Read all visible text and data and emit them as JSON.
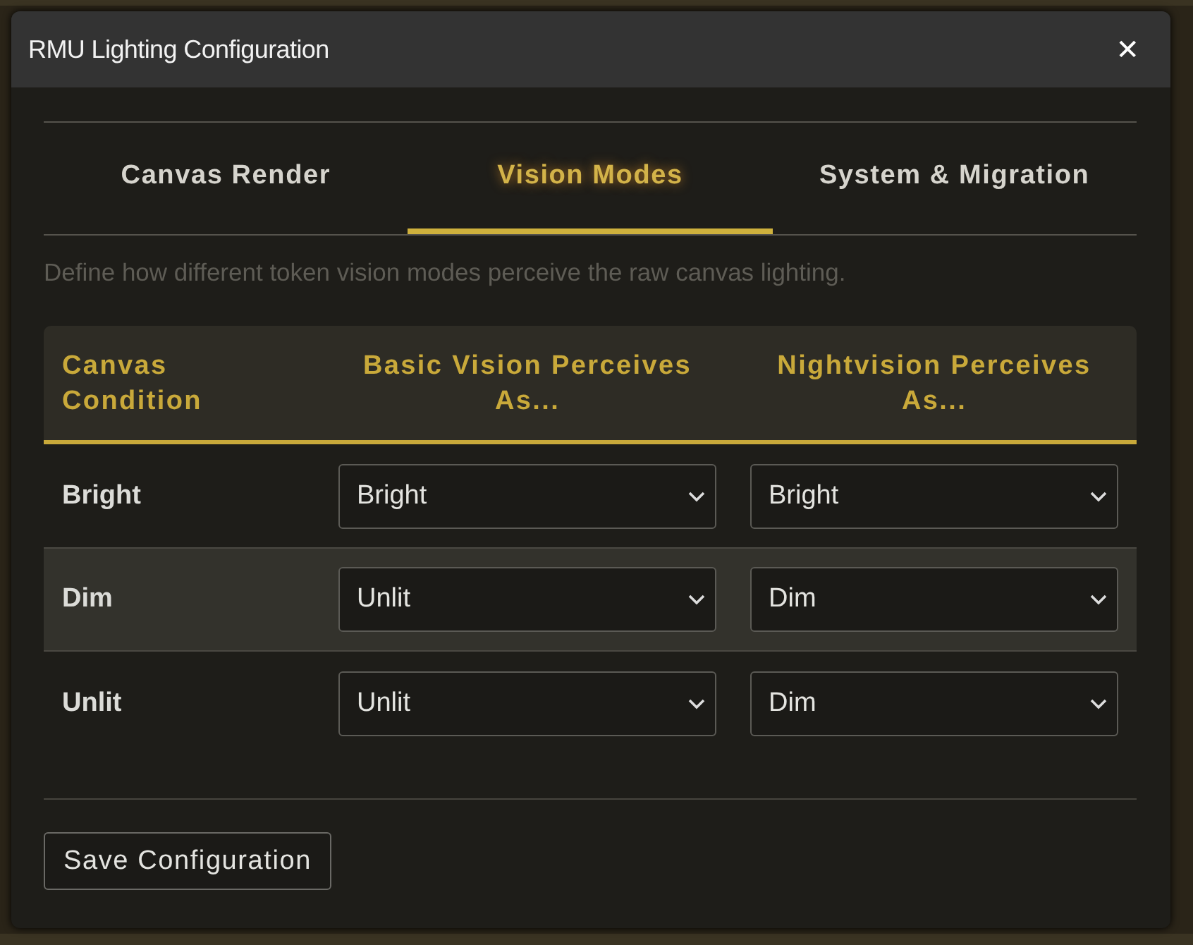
{
  "window": {
    "title": "RMU Lighting Configuration",
    "close": "✕"
  },
  "tabs": [
    {
      "label": "Canvas Render",
      "selected": false
    },
    {
      "label": "Vision Modes",
      "selected": true
    },
    {
      "label": "System & Migration",
      "selected": false
    }
  ],
  "description": "Define how different token vision modes perceive the raw canvas lighting.",
  "table": {
    "columns": [
      "Canvas Condition",
      "Basic Vision Perceives As...",
      "Nightvision Perceives As..."
    ],
    "rows": [
      {
        "condition": "Bright",
        "basic": "Bright",
        "nightvision": "Bright",
        "highlighted": false
      },
      {
        "condition": "Dim",
        "basic": "Unlit",
        "nightvision": "Dim",
        "highlighted": true
      },
      {
        "condition": "Unlit",
        "basic": "Unlit",
        "nightvision": "Dim",
        "highlighted": false
      }
    ]
  },
  "buttons": [
    "Save Configuration"
  ]
}
